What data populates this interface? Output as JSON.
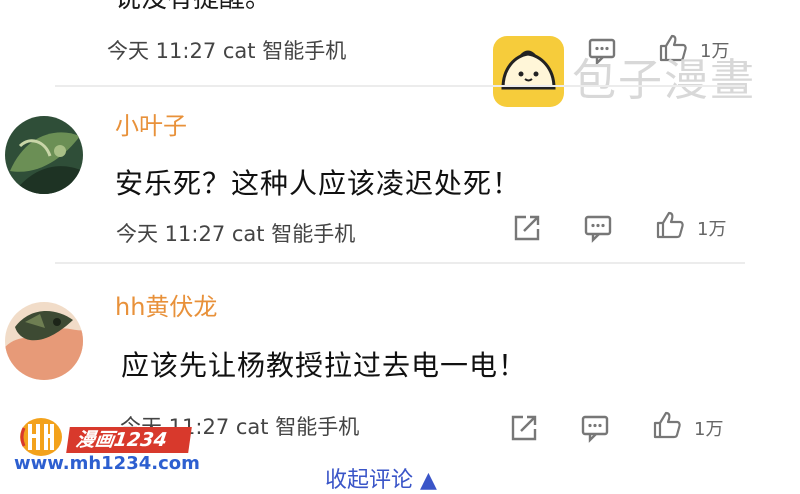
{
  "comments": [
    {
      "id": "c0",
      "partial_text": "说没有提醒。",
      "time": "今天 11:27",
      "user_tag": "cat 智能手机",
      "likes": "1万"
    },
    {
      "id": "c1",
      "name": "小叶子",
      "text": "安乐死？这种人应该凌迟处死！",
      "time": "今天 11:27",
      "user_tag": "cat 智能手机",
      "likes": "1万",
      "avatar_icon": "leaf-avatar"
    },
    {
      "id": "c2",
      "name": "hh黄伏龙",
      "text": "应该先让杨教授拉过去电一电！",
      "time": "今天 11:27",
      "user_tag": "cat 智能手机",
      "likes": "1万",
      "avatar_icon": "dragon-avatar"
    }
  ],
  "icons": {
    "share": "share-icon",
    "reply": "comment-icon",
    "like": "thumbs-up-icon"
  },
  "watermark": {
    "baozi_text": "包子漫畫",
    "site_title": "漫画1234",
    "site_url": "www.mh1234.com"
  },
  "footer": {
    "collapse_label": "收起评论"
  },
  "colors": {
    "username": "#e8913a",
    "baozi_badge": "#f6cc3b",
    "site_red": "#d8392c",
    "site_blue": "#2d5fd0",
    "collapse_blue": "#3a55c8"
  }
}
